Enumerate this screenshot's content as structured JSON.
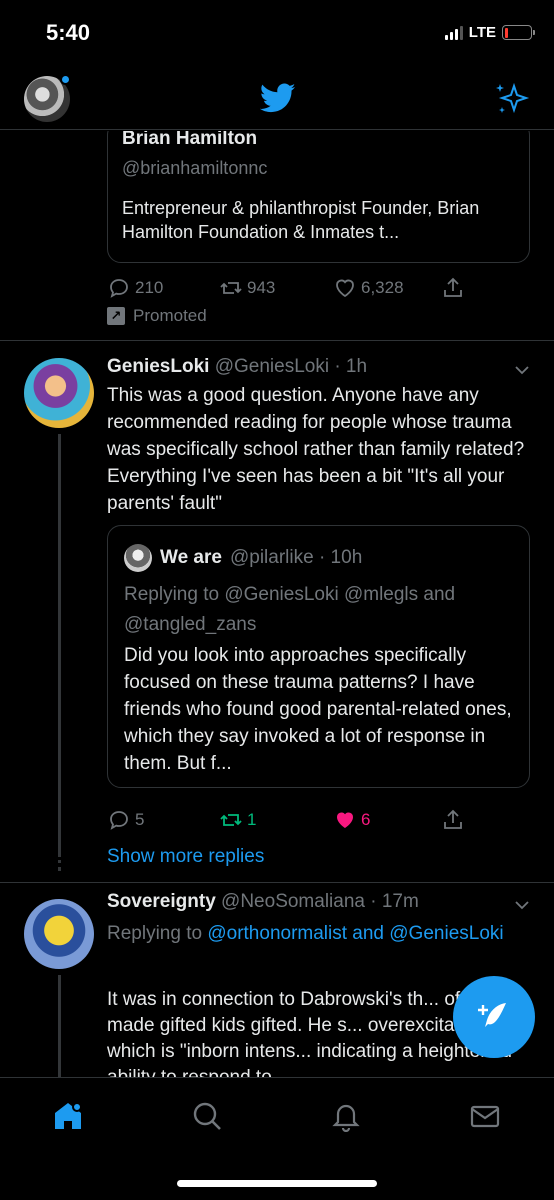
{
  "status": {
    "time": "5:40",
    "network": "LTE"
  },
  "header": {
    "logo": "twitter-bird-icon",
    "action": "sparkle-icon"
  },
  "promo": {
    "name": "Brian Hamilton",
    "handle": "@brianhamiltonnc",
    "bio": "Entrepreneur & philanthropist Founder, Brian Hamilton Foundation & Inmates t...",
    "replies": "210",
    "retweets": "943",
    "likes": "6,328",
    "promoted_label": "Promoted"
  },
  "tweet1": {
    "name": "GeniesLoki",
    "meta": "@GeniesLoki · 1h",
    "text": "This was a good question. Anyone have any recommended reading for people whose trauma was specifically school rather than family related? Everything I've seen has been a bit \"It's all your parents' fault\"",
    "quote": {
      "name": "We are",
      "meta": "@pilarlike · 10h",
      "replying": "Replying to @GeniesLoki @mlegls and @tangled_zans",
      "text": "Did you look into approaches specifically focused on these trauma patterns? I have friends who found good parental-related ones, which they say invoked a lot of response in them. But f..."
    },
    "replies": "5",
    "retweets": "1",
    "likes": "6"
  },
  "show_more": "Show more replies",
  "tweet2": {
    "name": "Sovereignty",
    "meta": "@NeoSomaliana · 17m",
    "replying_prefix": "Replying to",
    "replying_to": "@orthonormalist and @GeniesLoki",
    "text": "It was in connection to Dabrowski's th... of what made gifted kids gifted. He s... overexcitability which is \"inborn intens... indicating a heightened ability to respond to"
  },
  "colors": {
    "accent": "#1d9bf0",
    "like": "#f91880",
    "retweet": "#00ba7c",
    "background": "#000000"
  },
  "nav": [
    "home-icon",
    "search-icon",
    "notifications-icon",
    "messages-icon"
  ]
}
